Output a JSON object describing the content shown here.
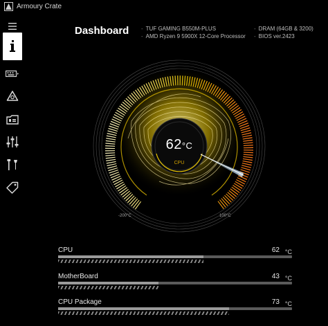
{
  "window": {
    "title": "Armoury Crate"
  },
  "sidebar": {
    "items": [
      {
        "icon": "hamburger-menu-icon"
      },
      {
        "icon": "info-icon",
        "active": true
      },
      {
        "icon": "keyboard-icon"
      },
      {
        "icon": "rgb-triangle-icon"
      },
      {
        "icon": "pc-device-icon"
      },
      {
        "icon": "sliders-icon"
      },
      {
        "icon": "tools-icon"
      },
      {
        "icon": "tag-icon"
      }
    ]
  },
  "dashboard": {
    "title": "Dashboard",
    "system_info": {
      "motherboard": "TUF GAMING B550M-PLUS",
      "cpu": "AMD Ryzen 9 5900X 12-Core Processor",
      "dram": "DRAM (64GB & 3200)",
      "bios": "BIOS ver.2423"
    }
  },
  "gauge": {
    "value": "62",
    "unit": "°C",
    "label": "CPU",
    "min_label": "-200°C",
    "max_label": "100°C",
    "accent_color": "#e8c400",
    "hot_color": "#ff7a1a"
  },
  "sensors": [
    {
      "name": "CPU",
      "value": "62",
      "unit": "°C",
      "fraction": 0.62
    },
    {
      "name": "MotherBoard",
      "value": "43",
      "unit": "°C",
      "fraction": 0.43
    },
    {
      "name": "CPU Package",
      "value": "73",
      "unit": "°C",
      "fraction": 0.73
    }
  ]
}
